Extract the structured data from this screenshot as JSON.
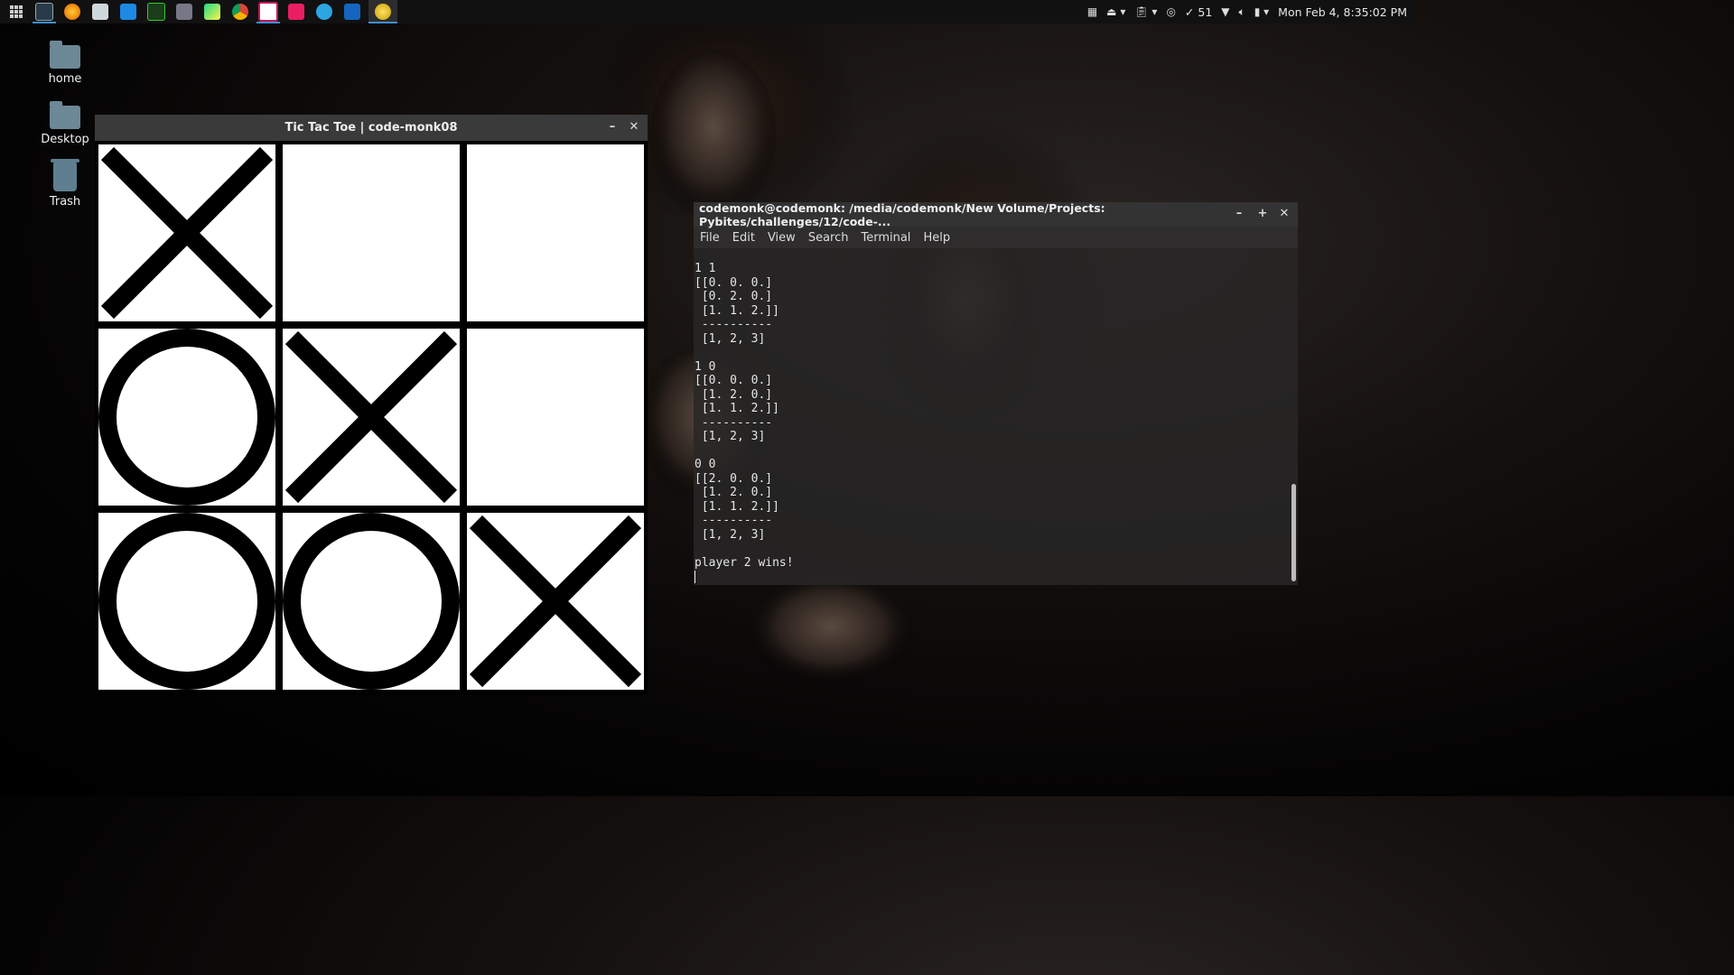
{
  "desktop": {
    "icons": [
      {
        "label": "home"
      },
      {
        "label": "Desktop"
      },
      {
        "label": "Trash"
      }
    ]
  },
  "panel": {
    "launcher": [
      {
        "icon": "app-grid-icon"
      },
      {
        "icon": "terminal-icon"
      },
      {
        "icon": "firefox-icon"
      },
      {
        "icon": "file-manager-icon"
      },
      {
        "icon": "vscode-icon"
      },
      {
        "icon": "system-monitor-icon"
      },
      {
        "icon": "screenshot-icon"
      },
      {
        "icon": "pycharm-icon"
      },
      {
        "icon": "chrome-icon"
      },
      {
        "icon": "sublime-text-icon"
      },
      {
        "icon": "music-app-icon"
      },
      {
        "icon": "telegram-icon"
      },
      {
        "icon": "wps-writer-icon"
      },
      {
        "icon": "python-game-icon"
      }
    ],
    "tray": {
      "updates_count": "51",
      "datetime": "Mon Feb  4,  8:35:02 PM"
    }
  },
  "tictactoe": {
    "title": "Tic Tac Toe | code-monk08",
    "minimize": "–",
    "close": "✕",
    "board": [
      "X",
      "",
      "",
      "O",
      "X",
      "",
      "O",
      "O",
      "X"
    ]
  },
  "terminal": {
    "title": "codemonk@codemonk: /media/codemonk/New Volume/Projects: Pybites/challenges/12/code-...",
    "minimize": "–",
    "maximize": "+",
    "close": "✕",
    "menu": [
      "File",
      "Edit",
      "View",
      "Search",
      "Terminal",
      "Help"
    ],
    "output": "1 1\n[[0. 0. 0.]\n [0. 2. 0.]\n [1. 1. 2.]]\n ----------\n [1, 2, 3]\n\n1 0\n[[0. 0. 0.]\n [1. 2. 0.]\n [1. 1. 2.]]\n ----------\n [1, 2, 3]\n\n0 0\n[[2. 0. 0.]\n [1. 2. 0.]\n [1. 1. 2.]]\n ----------\n [1, 2, 3]\n\nplayer 2 wins!\n"
  },
  "colors": {
    "panel_bg": "#111111",
    "accent": "#3d8fd6"
  }
}
